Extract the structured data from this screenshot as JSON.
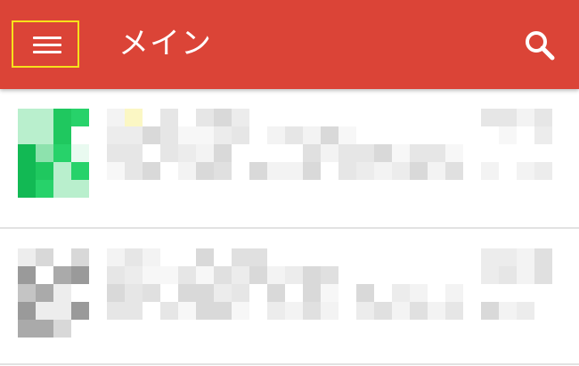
{
  "appbar": {
    "title": "メイン",
    "menu_icon": "hamburger-menu-icon",
    "search_icon": "search-icon",
    "colors": {
      "background": "#db4437",
      "highlight_border": "#f7e11b"
    }
  },
  "list": {
    "items": [
      {
        "avatar_style": "green",
        "content": "pixelated"
      },
      {
        "avatar_style": "gray",
        "content": "pixelated"
      }
    ]
  }
}
